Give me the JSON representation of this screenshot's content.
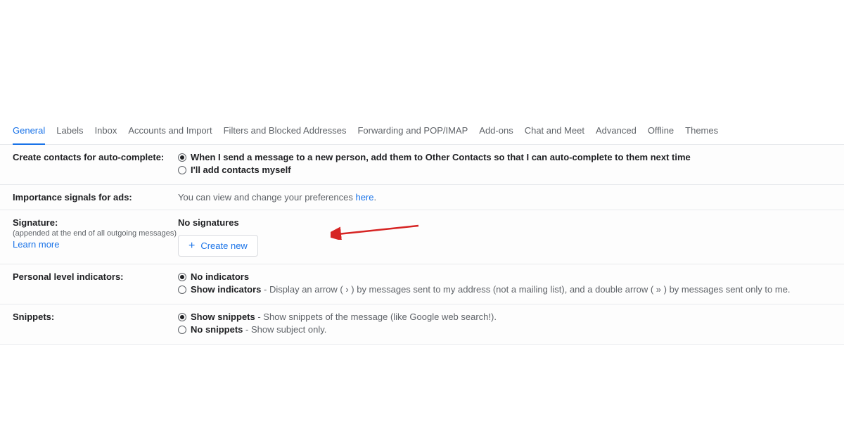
{
  "tabs": {
    "general": "General",
    "labels": "Labels",
    "inbox": "Inbox",
    "accounts": "Accounts and Import",
    "filters": "Filters and Blocked Addresses",
    "forwarding": "Forwarding and POP/IMAP",
    "addons": "Add-ons",
    "chat": "Chat and Meet",
    "advanced": "Advanced",
    "offline": "Offline",
    "themes": "Themes"
  },
  "contacts": {
    "label": "Create contacts for auto-complete:",
    "opt1": "When I send a message to a new person, add them to Other Contacts so that I can auto-complete to them next time",
    "opt2": "I'll add contacts myself"
  },
  "ads": {
    "label": "Importance signals for ads:",
    "text_pre": "You can view and change your preferences ",
    "here": "here",
    "text_post": "."
  },
  "signature": {
    "label": "Signature:",
    "sub": "(appended at the end of all outgoing messages)",
    "learn": "Learn more",
    "none": "No signatures",
    "create": "Create new"
  },
  "indicators": {
    "label": "Personal level indicators:",
    "opt1": "No indicators",
    "opt2_bold": "Show indicators",
    "opt2_rest": " - Display an arrow ( › ) by messages sent to my address (not a mailing list), and a double arrow ( » ) by messages sent only to me."
  },
  "snippets": {
    "label": "Snippets:",
    "opt1_bold": "Show snippets",
    "opt1_rest": " - Show snippets of the message (like Google web search!).",
    "opt2_bold": "No snippets",
    "opt2_rest": " - Show subject only."
  }
}
